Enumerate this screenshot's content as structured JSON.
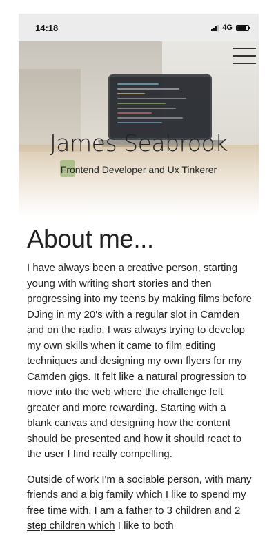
{
  "status_bar": {
    "time": "14:18",
    "network": "4G"
  },
  "hero": {
    "name": "James Seabrook",
    "tagline": "Frontend Developer and Ux Tinkerer"
  },
  "about": {
    "title": "About me...",
    "paragraph_1": "I have always been a creative person, starting young with writing short stories and then progressing into my teens by making films before DJing in my 20's with a regular slot in Camden and on the radio. I was always trying to develop my own skills when it came to film editing techniques and designing my own flyers for my Camden gigs. It felt like a natural progression to move into the web where the challenge felt greater and more rewarding. Starting with a blank canvas and designing how the content should be presented and how it should react to the user I find really compelling.",
    "paragraph_2_start": "Outside of work I'm a sociable person, with many friends and a big family which I like to spend my free time with. I am a father to 3 children and 2 ",
    "paragraph_2_underlined": "step children which",
    "paragraph_2_end": " I like to both"
  },
  "colors": {
    "status_bar_bg": "#ececec",
    "text": "#222222"
  }
}
